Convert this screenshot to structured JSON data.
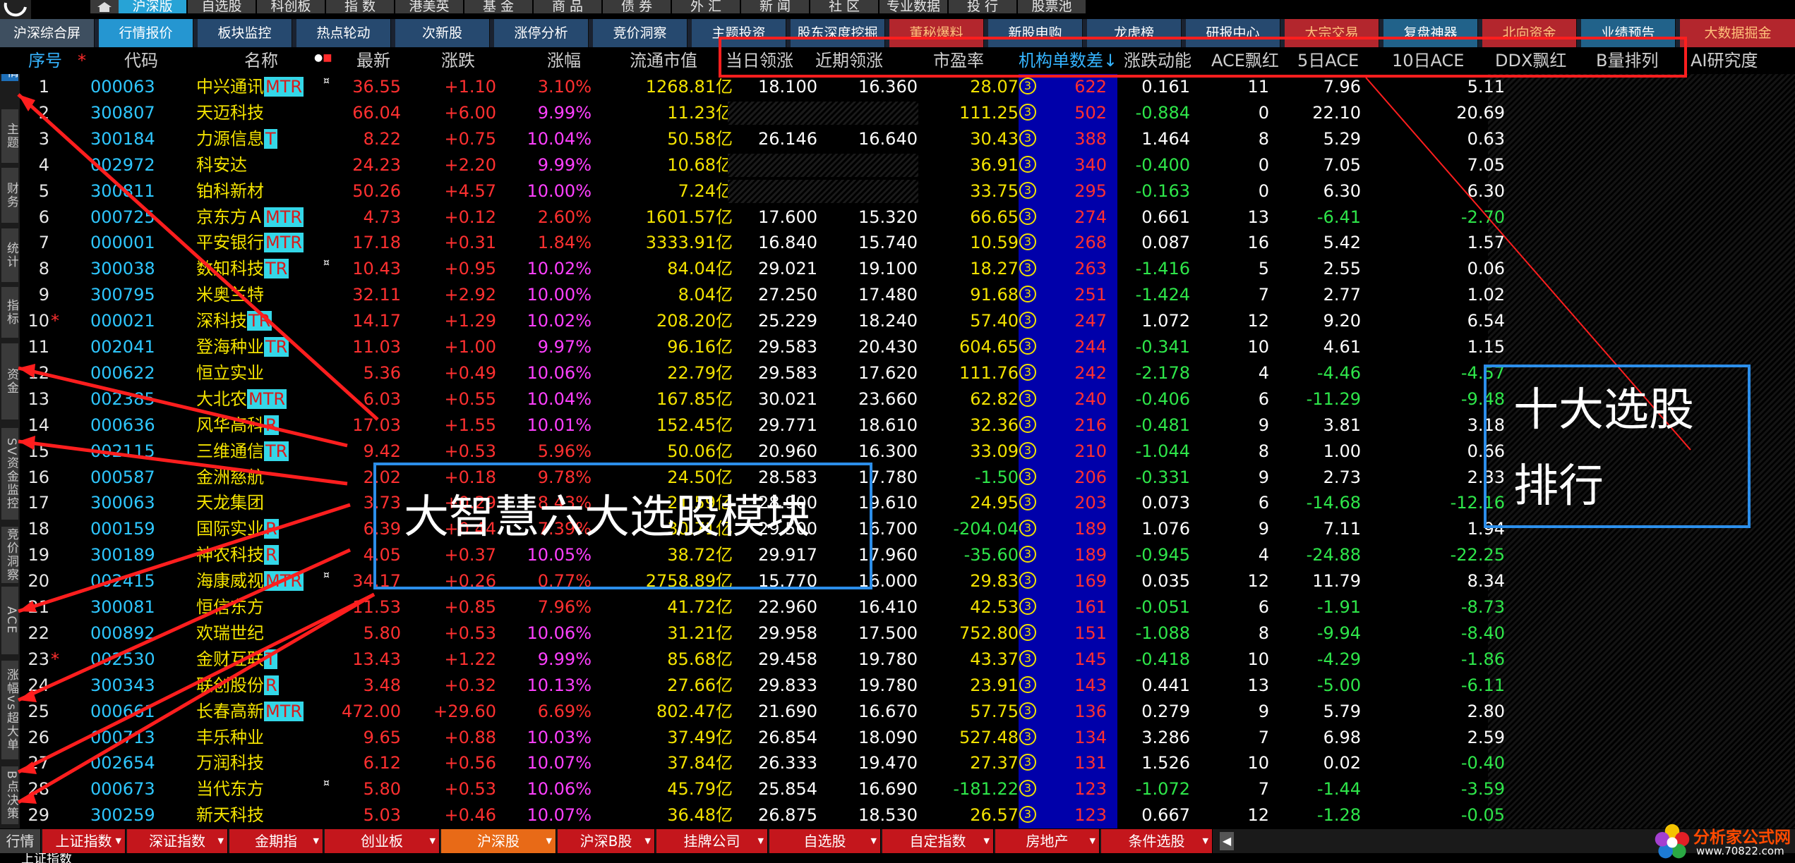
{
  "top_nav": {
    "items": [
      {
        "label": "沪深版",
        "active": true
      },
      {
        "label": "自选股"
      },
      {
        "label": "科创板"
      },
      {
        "label": "指 数"
      },
      {
        "label": "港美英"
      },
      {
        "label": "基 金"
      },
      {
        "label": "商 品"
      },
      {
        "label": "债 券"
      },
      {
        "label": "外 汇"
      },
      {
        "label": "新 闻"
      },
      {
        "label": "社 区"
      },
      {
        "label": "专业数据"
      },
      {
        "label": "投 行"
      },
      {
        "label": "股票池"
      }
    ]
  },
  "main_nav": {
    "items": [
      {
        "label": "沪深综合屏",
        "style": "gray"
      },
      {
        "label": "行情报价",
        "style": "active"
      },
      {
        "label": "板块监控",
        "style": "blue"
      },
      {
        "label": "热点轮动",
        "style": "blue"
      },
      {
        "label": "次新股",
        "style": "blue"
      },
      {
        "label": "涨停分析",
        "style": "blue"
      },
      {
        "label": "竞价洞察",
        "style": "blue"
      },
      {
        "label": "主题投资",
        "style": "blue"
      },
      {
        "label": "股东深度挖掘",
        "style": "blue"
      },
      {
        "label": "董秘爆料",
        "style": "red"
      },
      {
        "label": "新股申购",
        "style": "blue"
      },
      {
        "label": "龙虎榜",
        "style": "blue"
      },
      {
        "label": "研报中心",
        "style": "blue"
      },
      {
        "label": "大宗交易",
        "style": "red"
      },
      {
        "label": "复盘神器",
        "style": "teal"
      },
      {
        "label": "北向资金",
        "style": "red"
      },
      {
        "label": "业绩预告",
        "style": "teal"
      },
      {
        "label": "大数据掘金",
        "style": "red"
      }
    ]
  },
  "side_tabs": [
    "行情",
    "主题",
    "财务",
    "统计",
    "指标",
    "资金",
    "SV资金监控",
    "竞价洞察",
    "ACE",
    "涨幅vs超大单",
    "B点决策"
  ],
  "columns": {
    "no": "序号",
    "star": "*",
    "code": "代码",
    "name": "名称",
    "last": "最新",
    "chg": "涨跌",
    "pct": "涨幅",
    "mcap": "流通市值",
    "today_lead": "当日领涨",
    "recent_lead": "近期领涨",
    "pe": "市盈率",
    "inst": "机构单数差↓",
    "momentum": "涨跌动能",
    "ace_red": "ACE飘红",
    "ace5": "5日ACE",
    "ace10": "10日ACE",
    "ddx": "DDX飘红",
    "bvol": "B量排列",
    "ai": "AI研究度"
  },
  "rows": [
    {
      "no": "1",
      "star": "",
      "code": "000063",
      "name": "中兴通讯",
      "tag": "MTR",
      "note": "¤",
      "last": "36.55",
      "chg": "+1.10",
      "pct": "3.10%",
      "mcap": "1268.81亿",
      "tl": "18.100",
      "rl": "16.360",
      "pe": "28.07",
      "inst": "622",
      "mom": "0.161",
      "acer": "11",
      "a5": "7.96",
      "a10": "5.11",
      "pe_neg": false,
      "mom_neg": false,
      "a5_neg": false,
      "a10_neg": false,
      "limit": false
    },
    {
      "no": "2",
      "star": "",
      "code": "300807",
      "name": "天迈科技",
      "tag": "",
      "note": "",
      "last": "66.04",
      "chg": "+6.00",
      "pct": "9.99%",
      "mcap": "11.23亿",
      "tl": "",
      "rl": "",
      "pe": "111.25",
      "inst": "502",
      "mom": "-0.884",
      "acer": "0",
      "a5": "22.10",
      "a10": "20.69",
      "mom_neg": true,
      "limit": true
    },
    {
      "no": "3",
      "star": "",
      "code": "300184",
      "name": "力源信息",
      "tag": "T",
      "note": "",
      "last": "8.22",
      "chg": "+0.75",
      "pct": "10.04%",
      "mcap": "50.58亿",
      "tl": "26.146",
      "rl": "16.640",
      "pe": "30.43",
      "inst": "388",
      "mom": "1.464",
      "acer": "8",
      "a5": "5.29",
      "a10": "0.63",
      "limit": true
    },
    {
      "no": "4",
      "star": "",
      "code": "002972",
      "name": "科安达",
      "tag": "",
      "note": "",
      "last": "24.23",
      "chg": "+2.20",
      "pct": "9.99%",
      "mcap": "10.68亿",
      "tl": "",
      "rl": "",
      "pe": "36.91",
      "inst": "340",
      "mom": "-0.400",
      "acer": "0",
      "a5": "7.05",
      "a10": "7.05",
      "mom_neg": true,
      "limit": true
    },
    {
      "no": "5",
      "star": "",
      "code": "300811",
      "name": "铂科新材",
      "tag": "",
      "note": "",
      "last": "50.26",
      "chg": "+4.57",
      "pct": "10.00%",
      "mcap": "7.24亿",
      "tl": "",
      "rl": "",
      "pe": "33.75",
      "inst": "295",
      "mom": "-0.163",
      "acer": "0",
      "a5": "6.30",
      "a10": "6.30",
      "mom_neg": true,
      "limit": true
    },
    {
      "no": "6",
      "star": "",
      "code": "000725",
      "name": "京东方Ａ",
      "tag": "MTR",
      "note": "",
      "last": "4.73",
      "chg": "+0.12",
      "pct": "2.60%",
      "mcap": "1601.57亿",
      "tl": "17.600",
      "rl": "15.320",
      "pe": "66.65",
      "inst": "274",
      "mom": "0.661",
      "acer": "13",
      "a5": "-6.41",
      "a10": "-2.70",
      "a5_neg": true,
      "a10_neg": true
    },
    {
      "no": "7",
      "star": "",
      "code": "000001",
      "name": "平安银行",
      "tag": "MTR",
      "note": "",
      "last": "17.18",
      "chg": "+0.31",
      "pct": "1.84%",
      "mcap": "3333.91亿",
      "tl": "16.840",
      "rl": "15.740",
      "pe": "10.59",
      "inst": "268",
      "mom": "0.087",
      "acer": "16",
      "a5": "5.42",
      "a10": "1.57"
    },
    {
      "no": "8",
      "star": "",
      "code": "300038",
      "name": "数知科技",
      "tag": "TR",
      "note": "¤",
      "last": "10.43",
      "chg": "+0.95",
      "pct": "10.02%",
      "mcap": "84.04亿",
      "tl": "29.021",
      "rl": "19.100",
      "pe": "18.27",
      "inst": "263",
      "mom": "-1.416",
      "acer": "5",
      "a5": "2.55",
      "a10": "0.06",
      "mom_neg": true,
      "limit": true
    },
    {
      "no": "9",
      "star": "",
      "code": "300795",
      "name": "米奥兰特",
      "tag": "",
      "note": "",
      "last": "32.11",
      "chg": "+2.92",
      "pct": "10.00%",
      "mcap": "8.04亿",
      "tl": "27.250",
      "rl": "17.480",
      "pe": "91.68",
      "inst": "251",
      "mom": "-1.424",
      "acer": "7",
      "a5": "2.77",
      "a10": "1.02",
      "mom_neg": true,
      "limit": true
    },
    {
      "no": "10",
      "star": "*",
      "code": "000021",
      "name": "深科技",
      "tag": "TR",
      "note": "",
      "last": "14.17",
      "chg": "+1.29",
      "pct": "10.02%",
      "mcap": "208.20亿",
      "tl": "25.229",
      "rl": "18.240",
      "pe": "57.40",
      "inst": "247",
      "mom": "1.072",
      "acer": "12",
      "a5": "9.20",
      "a10": "6.54",
      "limit": true
    },
    {
      "no": "11",
      "star": "",
      "code": "002041",
      "name": "登海种业",
      "tag": "TR",
      "note": "",
      "last": "11.03",
      "chg": "+1.00",
      "pct": "9.97%",
      "mcap": "96.16亿",
      "tl": "29.583",
      "rl": "20.430",
      "pe": "604.65",
      "inst": "244",
      "mom": "-0.341",
      "acer": "10",
      "a5": "4.61",
      "a10": "1.15",
      "mom_neg": true,
      "limit": true
    },
    {
      "no": "12",
      "star": "",
      "code": "000622",
      "name": "恒立实业",
      "tag": "",
      "note": "",
      "last": "5.36",
      "chg": "+0.49",
      "pct": "10.06%",
      "mcap": "22.79亿",
      "tl": "29.583",
      "rl": "17.620",
      "pe": "111.76",
      "inst": "242",
      "mom": "-2.178",
      "acer": "4",
      "a5": "-4.46",
      "a10": "-4.57",
      "mom_neg": true,
      "a5_neg": true,
      "a10_neg": true,
      "limit": true
    },
    {
      "no": "13",
      "star": "",
      "code": "002385",
      "name": "大北农",
      "tag": "MTR",
      "note": "",
      "last": "6.03",
      "chg": "+0.55",
      "pct": "10.04%",
      "mcap": "167.85亿",
      "tl": "30.021",
      "rl": "23.660",
      "pe": "62.82",
      "inst": "240",
      "mom": "-0.406",
      "acer": "6",
      "a5": "-11.29",
      "a10": "-9.48",
      "mom_neg": true,
      "a5_neg": true,
      "a10_neg": true,
      "limit": true
    },
    {
      "no": "14",
      "star": "",
      "code": "000636",
      "name": "风华高科",
      "tag": "R",
      "note": "",
      "last": "17.03",
      "chg": "+1.55",
      "pct": "10.01%",
      "mcap": "152.45亿",
      "tl": "29.771",
      "rl": "18.610",
      "pe": "32.36",
      "inst": "216",
      "mom": "-0.481",
      "acer": "9",
      "a5": "3.81",
      "a10": "3.18",
      "mom_neg": true,
      "limit": true
    },
    {
      "no": "15",
      "star": "",
      "code": "002115",
      "name": "三维通信",
      "tag": "TR",
      "note": "",
      "last": "9.42",
      "chg": "+0.53",
      "pct": "5.96%",
      "mcap": "50.06亿",
      "tl": "20.960",
      "rl": "16.300",
      "pe": "33.09",
      "inst": "210",
      "mom": "-1.044",
      "acer": "8",
      "a5": "1.00",
      "a10": "0.66",
      "mom_neg": true
    },
    {
      "no": "16",
      "star": "",
      "code": "000587",
      "name": "金洲慈航",
      "tag": "",
      "note": "",
      "last": "2.02",
      "chg": "+0.18",
      "pct": "9.78%",
      "mcap": "24.50亿",
      "tl": "28.583",
      "rl": "17.780",
      "pe": "-1.50",
      "inst": "206",
      "mom": "-0.331",
      "acer": "9",
      "a5": "2.73",
      "a10": "2.33",
      "pe_neg": true,
      "mom_neg": true
    },
    {
      "no": "17",
      "star": "",
      "code": "300063",
      "name": "天龙集团",
      "tag": "",
      "note": "",
      "last": "3.73",
      "chg": "+0.29",
      "pct": "8.43%",
      "mcap": "21.59亿",
      "tl": "28.900",
      "rl": "19.610",
      "pe": "24.95",
      "inst": "203",
      "mom": "0.073",
      "acer": "6",
      "a5": "-14.68",
      "a10": "-12.16",
      "a5_neg": true,
      "a10_neg": true
    },
    {
      "no": "18",
      "star": "",
      "code": "000159",
      "name": "国际实业",
      "tag": "R",
      "note": "",
      "last": "6.39",
      "chg": "+0.44",
      "pct": "7.39%",
      "mcap": "30.71亿",
      "tl": "29.500",
      "rl": "16.700",
      "pe": "-204.04",
      "inst": "189",
      "mom": "1.076",
      "acer": "9",
      "a5": "7.11",
      "a10": "1.94",
      "pe_neg": true
    },
    {
      "no": "19",
      "star": "",
      "code": "300189",
      "name": "神农科技",
      "tag": "R",
      "note": "",
      "last": "4.05",
      "chg": "+0.37",
      "pct": "10.05%",
      "mcap": "38.72亿",
      "tl": "29.917",
      "rl": "17.960",
      "pe": "-35.60",
      "inst": "189",
      "mom": "-0.945",
      "acer": "4",
      "a5": "-24.88",
      "a10": "-22.25",
      "pe_neg": true,
      "mom_neg": true,
      "a5_neg": true,
      "a10_neg": true,
      "limit": true
    },
    {
      "no": "20",
      "star": "",
      "code": "002415",
      "name": "海康威视",
      "tag": "MTR",
      "note": "¤",
      "last": "34.17",
      "chg": "+0.26",
      "pct": "0.77%",
      "mcap": "2758.89亿",
      "tl": "15.770",
      "rl": "16.000",
      "pe": "29.83",
      "inst": "169",
      "mom": "0.035",
      "acer": "12",
      "a5": "11.79",
      "a10": "8.34"
    },
    {
      "no": "21",
      "star": "",
      "code": "300081",
      "name": "恒信东方",
      "tag": "",
      "note": "",
      "last": "11.53",
      "chg": "+0.85",
      "pct": "7.96%",
      "mcap": "41.72亿",
      "tl": "22.960",
      "rl": "16.410",
      "pe": "42.53",
      "inst": "161",
      "mom": "-0.051",
      "acer": "6",
      "a5": "-1.91",
      "a10": "-8.73",
      "mom_neg": true,
      "a5_neg": true,
      "a10_neg": true
    },
    {
      "no": "22",
      "star": "",
      "code": "000892",
      "name": "欢瑞世纪",
      "tag": "",
      "note": "",
      "last": "5.80",
      "chg": "+0.53",
      "pct": "10.06%",
      "mcap": "31.21亿",
      "tl": "29.958",
      "rl": "17.500",
      "pe": "752.80",
      "inst": "151",
      "mom": "-1.088",
      "acer": "8",
      "a5": "-9.94",
      "a10": "-8.40",
      "mom_neg": true,
      "a5_neg": true,
      "a10_neg": true,
      "limit": true
    },
    {
      "no": "23",
      "star": "*",
      "code": "002530",
      "name": "金财互联",
      "tag": "T",
      "note": "",
      "last": "13.43",
      "chg": "+1.22",
      "pct": "9.99%",
      "mcap": "85.68亿",
      "tl": "29.458",
      "rl": "19.780",
      "pe": "43.37",
      "inst": "145",
      "mom": "-0.418",
      "acer": "10",
      "a5": "-4.29",
      "a10": "-1.86",
      "mom_neg": true,
      "a5_neg": true,
      "a10_neg": true,
      "limit": true
    },
    {
      "no": "24",
      "star": "",
      "code": "300343",
      "name": "联创股份",
      "tag": "R",
      "note": "",
      "last": "3.48",
      "chg": "+0.32",
      "pct": "10.13%",
      "mcap": "27.66亿",
      "tl": "29.833",
      "rl": "19.780",
      "pe": "23.91",
      "inst": "143",
      "mom": "0.441",
      "acer": "13",
      "a5": "-5.00",
      "a10": "-6.11",
      "a5_neg": true,
      "a10_neg": true,
      "limit": true
    },
    {
      "no": "25",
      "star": "",
      "code": "000661",
      "name": "长春高新",
      "tag": "MTR",
      "note": "",
      "last": "472.00",
      "chg": "+29.60",
      "pct": "6.69%",
      "mcap": "802.47亿",
      "tl": "21.690",
      "rl": "16.670",
      "pe": "57.75",
      "inst": "136",
      "mom": "0.279",
      "acer": "9",
      "a5": "5.79",
      "a10": "2.80"
    },
    {
      "no": "26",
      "star": "",
      "code": "000713",
      "name": "丰乐种业",
      "tag": "",
      "note": "",
      "last": "9.65",
      "chg": "+0.88",
      "pct": "10.03%",
      "mcap": "37.49亿",
      "tl": "26.854",
      "rl": "18.090",
      "pe": "527.48",
      "inst": "134",
      "mom": "3.286",
      "acer": "7",
      "a5": "6.98",
      "a10": "2.59",
      "limit": true
    },
    {
      "no": "27",
      "star": "",
      "code": "002654",
      "name": "万润科技",
      "tag": "",
      "note": "",
      "last": "6.12",
      "chg": "+0.56",
      "pct": "10.07%",
      "mcap": "37.84亿",
      "tl": "26.333",
      "rl": "19.470",
      "pe": "27.37",
      "inst": "131",
      "mom": "1.526",
      "acer": "10",
      "a5": "0.02",
      "a10": "-0.40",
      "a10_neg": true,
      "limit": true
    },
    {
      "no": "28",
      "star": "",
      "code": "000673",
      "name": "当代东方",
      "tag": "",
      "note": "¤",
      "last": "5.80",
      "chg": "+0.53",
      "pct": "10.06%",
      "mcap": "45.79亿",
      "tl": "25.854",
      "rl": "16.690",
      "pe": "-181.22",
      "inst": "123",
      "mom": "-1.072",
      "acer": "7",
      "a5": "-1.44",
      "a10": "-3.59",
      "pe_neg": true,
      "mom_neg": true,
      "a5_neg": true,
      "a10_neg": true,
      "limit": true
    },
    {
      "no": "29",
      "star": "",
      "code": "300259",
      "name": "新天科技",
      "tag": "",
      "note": "",
      "last": "5.03",
      "chg": "+0.46",
      "pct": "10.07%",
      "mcap": "36.48亿",
      "tl": "26.875",
      "rl": "18.530",
      "pe": "26.57",
      "inst": "123",
      "mom": "0.667",
      "acer": "12",
      "a5": "-1.28",
      "a10": "-0.05",
      "a5_neg": true,
      "a10_neg": true,
      "limit": true
    }
  ],
  "bottom_tabs": [
    {
      "label": "行情",
      "style": "gray"
    },
    {
      "label": "上证指数",
      "style": "red"
    },
    {
      "label": "深证指数",
      "style": "red"
    },
    {
      "label": "金期指",
      "style": "red"
    },
    {
      "label": "创业板",
      "style": "red"
    },
    {
      "label": "沪深股",
      "style": "or"
    },
    {
      "label": "沪深B股",
      "style": "red"
    },
    {
      "label": "挂牌公司",
      "style": "red"
    },
    {
      "label": "自选股",
      "style": "red"
    },
    {
      "label": "自定指数",
      "style": "red"
    },
    {
      "label": "房地产",
      "style": "red"
    },
    {
      "label": "条件选股",
      "style": "red"
    }
  ],
  "callouts": {
    "left": "大智慧六大选股模块",
    "right_line1": "十大选股",
    "right_line2": "排行"
  },
  "brand": {
    "name": "分析家公式网",
    "url": "www.70822.com"
  },
  "colors": {
    "up": "#ff3030",
    "down": "#2ee64a",
    "accent": "#27a3d6",
    "inst_col": "#0000aa",
    "annotation_red": "#ff1e1e",
    "annotation_blue": "#2c8eea"
  }
}
